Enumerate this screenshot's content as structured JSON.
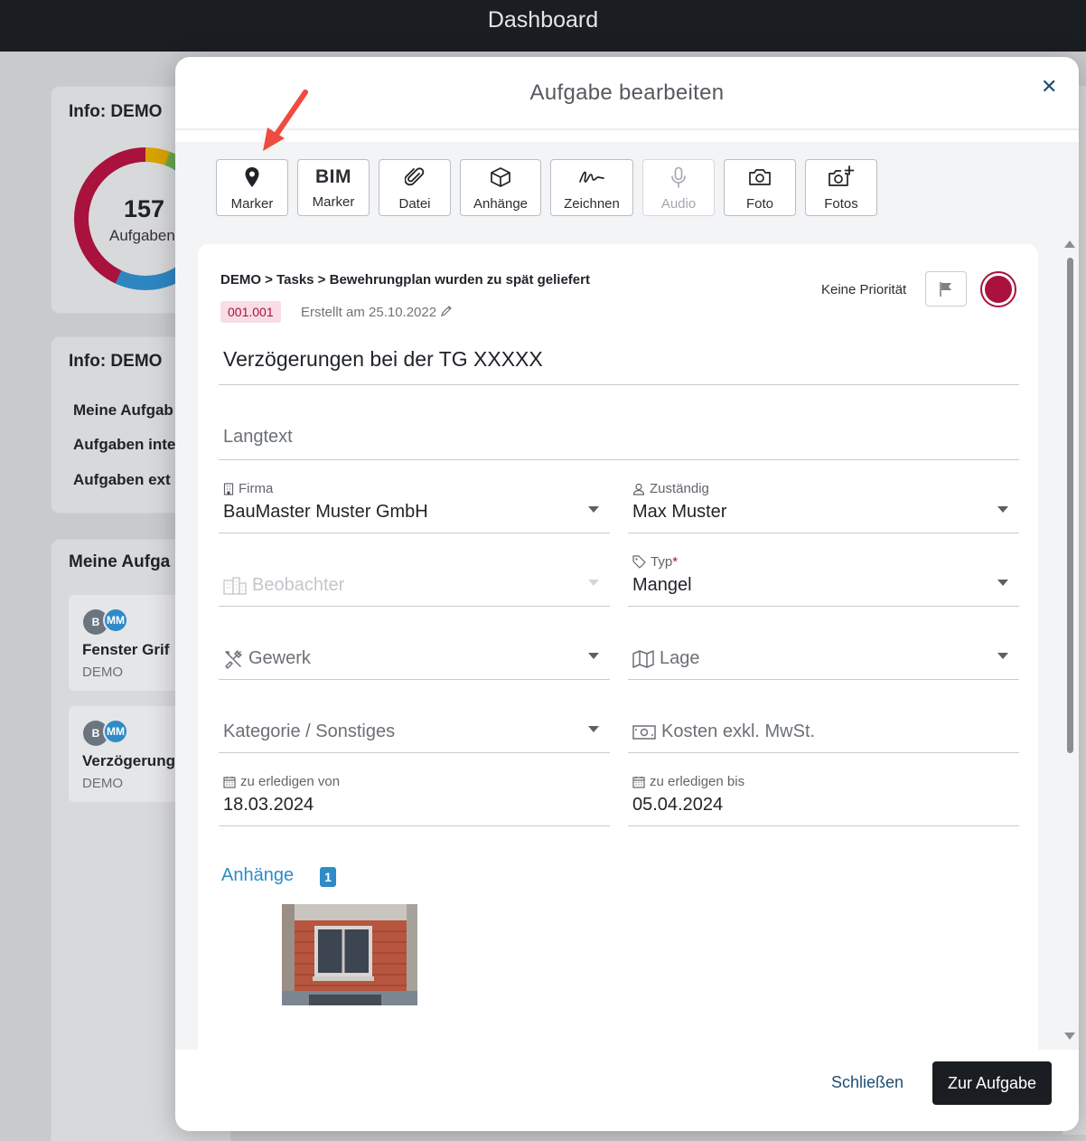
{
  "topbar": {
    "title": "Dashboard"
  },
  "background": {
    "card1_title": "Info: DEMO",
    "donut_count": "157",
    "donut_label": "Aufgaben",
    "card2_title": "Info: DEMO",
    "info_lines": [
      "Meine Aufgab",
      "Aufgaben inte",
      "Aufgaben ext"
    ],
    "card3_title": "Meine Aufga",
    "tasks": [
      {
        "avatar1": "B",
        "avatar2": "MM",
        "title": "Fenster Grif",
        "project": "DEMO"
      },
      {
        "avatar1": "B",
        "avatar2": "MM",
        "title": "Verzögerung",
        "project": "DEMO"
      }
    ]
  },
  "modal": {
    "title": "Aufgabe bearbeiten",
    "close_icon": "close-icon",
    "toolbar": {
      "marker": "Marker",
      "bim_top": "BIM",
      "bim_marker": "Marker",
      "datei": "Datei",
      "anhaenge": "Anhänge",
      "zeichnen": "Zeichnen",
      "audio": "Audio",
      "foto": "Foto",
      "fotos": "Fotos"
    },
    "breadcrumb": "DEMO > Tasks > Bewehrungplan wurden zu spät geliefert",
    "task_id": "001.001",
    "created": "Erstellt am 25.10.2022",
    "priority_label": "Keine Priorität",
    "status_color": "#a8123d",
    "title_value": "Verzögerungen bei der TG XXXXX",
    "langtext_placeholder": "Langtext",
    "firma": {
      "label": "Firma",
      "value": "BauMaster Muster GmbH"
    },
    "zustaendig": {
      "label": "Zuständig",
      "value": "Max Muster"
    },
    "beobachter": {
      "placeholder": "Beobachter"
    },
    "typ": {
      "label": "Typ",
      "required_mark": "*",
      "value": "Mangel"
    },
    "gewerk": {
      "placeholder": "Gewerk"
    },
    "lage": {
      "placeholder": "Lage"
    },
    "kategorie": {
      "placeholder": "Kategorie / Sonstiges"
    },
    "kosten": {
      "placeholder": "Kosten exkl. MwSt."
    },
    "von": {
      "label": "zu erledigen von",
      "value": "18.03.2024"
    },
    "bis": {
      "label": "zu erledigen bis",
      "value": "05.04.2024"
    },
    "attachments": {
      "label": "Anhänge",
      "count": "1"
    },
    "footer": {
      "close": "Schließen",
      "go": "Zur Aufgabe"
    }
  }
}
